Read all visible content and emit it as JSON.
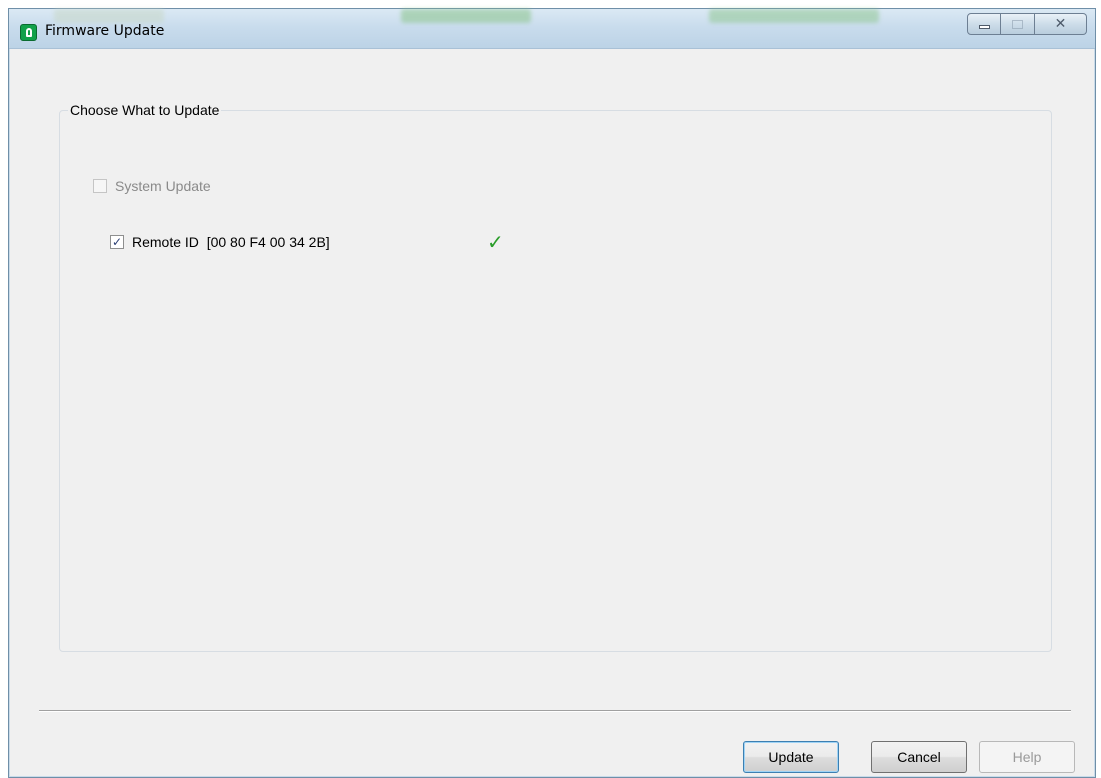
{
  "window": {
    "title": "Firmware Update"
  },
  "group": {
    "legend": "Choose What to Update",
    "items": [
      {
        "label": "System Update",
        "checked": false,
        "enabled": false
      },
      {
        "label": "Remote ID  [00 80 F4 00 34 2B]",
        "checked": true,
        "enabled": true,
        "status_mark": "✓"
      }
    ]
  },
  "buttons": {
    "update": "Update",
    "cancel": "Cancel",
    "help": "Help"
  },
  "icons": {
    "app": "app-shield-icon",
    "minimize": "minimize-icon",
    "maximize": "maximize-icon",
    "close": "close-icon",
    "status": "checkmark-icon"
  },
  "colors": {
    "app_icon": "#12a14a",
    "status_check": "#2a9d2a",
    "default_button_border": "#3c7fb1"
  }
}
